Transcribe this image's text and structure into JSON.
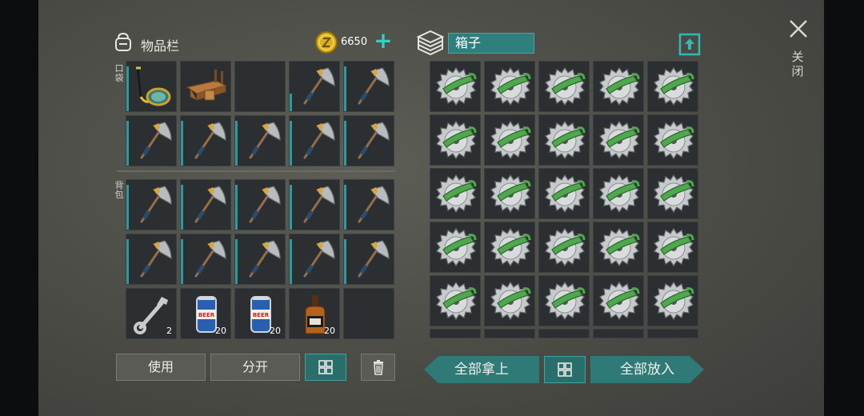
{
  "inventory": {
    "title": "物品栏",
    "coins": "6650",
    "pocket_label": "口袋",
    "backpack_label": "背包",
    "pocket_slots": [
      {
        "item": "scuba-mask",
        "count": "",
        "bar": 0.9
      },
      {
        "item": "workbench",
        "count": "",
        "bar": 0
      },
      {
        "item": "",
        "count": "",
        "bar": 0
      },
      {
        "item": "hatchet",
        "count": "",
        "bar": 0.35
      },
      {
        "item": "hatchet",
        "count": "",
        "bar": 0.9
      },
      {
        "item": "hatchet",
        "count": "",
        "bar": 0.9
      },
      {
        "item": "hatchet",
        "count": "",
        "bar": 0.9
      },
      {
        "item": "hatchet",
        "count": "",
        "bar": 0.9
      },
      {
        "item": "hatchet",
        "count": "",
        "bar": 0.9
      },
      {
        "item": "hatchet",
        "count": "",
        "bar": 0.9
      }
    ],
    "backpack_slots": [
      {
        "item": "hatchet",
        "count": "",
        "bar": 0.9
      },
      {
        "item": "hatchet",
        "count": "",
        "bar": 0.9
      },
      {
        "item": "hatchet",
        "count": "",
        "bar": 0.9
      },
      {
        "item": "hatchet",
        "count": "",
        "bar": 0.9
      },
      {
        "item": "hatchet",
        "count": "",
        "bar": 0.9
      },
      {
        "item": "hatchet",
        "count": "",
        "bar": 0.9
      },
      {
        "item": "hatchet",
        "count": "",
        "bar": 0.9
      },
      {
        "item": "hatchet",
        "count": "",
        "bar": 0.9
      },
      {
        "item": "hatchet",
        "count": "",
        "bar": 0.9
      },
      {
        "item": "hatchet",
        "count": "",
        "bar": 0.9
      },
      {
        "item": "wrench",
        "count": "2",
        "bar": 0
      },
      {
        "item": "beer-can",
        "count": "20",
        "bar": 0
      },
      {
        "item": "beer-can",
        "count": "20",
        "bar": 0
      },
      {
        "item": "whiskey-bottle",
        "count": "20",
        "bar": 0
      },
      {
        "item": "",
        "count": "",
        "bar": 0
      }
    ],
    "buttons": {
      "use": "使用",
      "split": "分开"
    }
  },
  "container": {
    "name": "箱子",
    "item": "saw-blade",
    "rows": 5,
    "cols": 5,
    "buttons": {
      "take_all": "全部拿上",
      "put_all": "全部放入"
    }
  },
  "close_label": "关闭",
  "colors": {
    "accent": "#2a9b9f",
    "coin": "#d9b21c",
    "plus": "#2fd2c4",
    "button_teal": "#2f7a77"
  }
}
